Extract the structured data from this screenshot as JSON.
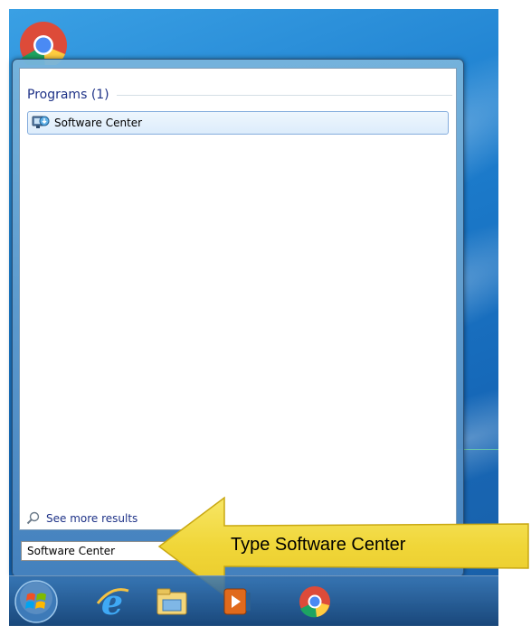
{
  "search_results": {
    "group_header": "Programs (1)",
    "items": [
      {
        "label": "Software Center",
        "icon": "software-center-icon"
      }
    ],
    "see_more": "See more results"
  },
  "search": {
    "value": "Software Center"
  },
  "annotation": {
    "text": "Type Software Center"
  },
  "taskbar": {
    "items": [
      "start-orb",
      "internet-explorer-icon",
      "file-explorer-icon",
      "media-player-icon",
      "chrome-icon"
    ]
  },
  "colors": {
    "header_text": "#1e3287",
    "highlight_border": "#84acdd",
    "callout_fill": "#f3dc3e",
    "desktop": "#1d7fcf"
  }
}
